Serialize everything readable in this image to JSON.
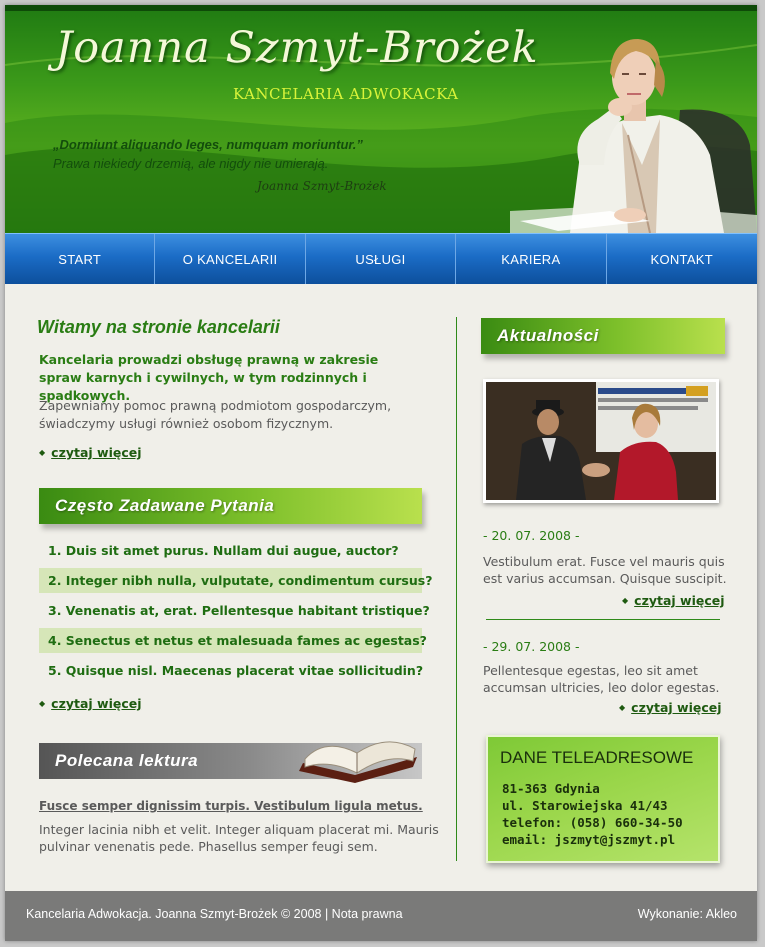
{
  "header": {
    "title": "Joanna Szmyt-Brożek",
    "subtitle": "KANCELARIA ADWOKACKA",
    "quote_latin": "„Dormiunt aliquando leges, numquam moriuntur.”",
    "quote_polish": "Prawa niekiedy drzemią, ale nigdy nie umierają.",
    "quote_signature": "Joanna Szmyt-Brożek"
  },
  "nav": {
    "items": [
      "START",
      "O KANCELARII",
      "USŁUGI",
      "KARIERA",
      "KONTAKT"
    ]
  },
  "welcome": {
    "heading": "Witamy na stronie kancelarii",
    "intro_bold": "Kancelaria prowadzi obsługę prawną w zakresie spraw karnych i cywilnych, w tym rodzinnych i spadkowych.",
    "intro_text": "Zapewniamy pomoc prawną podmiotom gospodarczym, świadczymy usługi również osobom fizycznym.",
    "more_label": "czytaj więcej"
  },
  "faq": {
    "heading": "Często Zadawane Pytania",
    "items": [
      "1. Duis sit amet purus. Nullam dui augue, auctor?",
      "2. Integer nibh nulla, vulputate, condimentum cursus?",
      "3. Venenatis at, erat. Pellentesque habitant tristique?",
      "4. Senectus et netus et malesuada fames ac egestas?",
      "5. Quisque nisl. Maecenas placerat vitae sollicitudin?"
    ],
    "more_label": "czytaj więcej"
  },
  "reading": {
    "heading": "Polecana lektura",
    "link": "Fusce semper dignissim turpis. Vestibulum ligula metus.",
    "text": "Integer lacinia nibh et velit. Integer aliquam placerat mi. Mauris pulvinar venenatis pede. Phasellus semper feugi sem."
  },
  "news": {
    "heading": "Aktualności",
    "items": [
      {
        "date": "- 20. 07. 2008 -",
        "text": "Vestibulum erat. Fusce vel mauris quis est varius accumsan. Quisque suscipit.",
        "more_label": "czytaj więcej"
      },
      {
        "date": "- 29. 07. 2008 -",
        "text": "Pellentesque egestas, leo sit amet accumsan ultricies, leo dolor egestas.",
        "more_label": "czytaj więcej"
      }
    ]
  },
  "contact": {
    "title": "DANE TELEADRESOWE",
    "lines": [
      "81-363 Gdynia",
      "ul. Starowiejska 41/43",
      "telefon: (058) 660-34-50",
      "email: jszmyt@jszmyt.pl"
    ]
  },
  "footer": {
    "left": "Kancelaria Adwokacja. Joanna Szmyt-Brożek © 2008 | Nota prawna",
    "right": "Wykonanie: Akleo"
  },
  "colors": {
    "accent_green": "#2a7d14",
    "nav_blue": "#1b6cc6",
    "faq_highlight": "#d6e6b8",
    "page_bg": "#f0efe9",
    "footer_bg": "#7a7a79"
  }
}
